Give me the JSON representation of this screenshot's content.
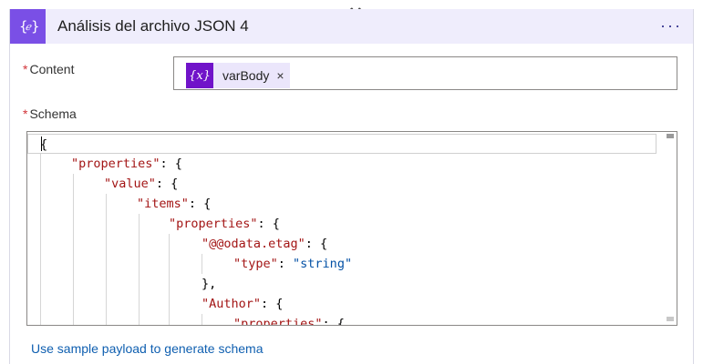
{
  "action": {
    "title": "Análisis del archivo JSON 4",
    "more_label": "···"
  },
  "content_field": {
    "label": "Content",
    "required_mark": "*",
    "token": {
      "icon_text": "{x}",
      "label": "varBody",
      "remove_label": "×"
    }
  },
  "schema_field": {
    "label": "Schema",
    "required_mark": "*"
  },
  "schema_lines": [
    "{",
    "\"properties\": {",
    "\"value\": {",
    "\"items\": {",
    "\"properties\": {",
    "\"@@odata.etag\": {",
    "\"type\": \"string\"",
    "},",
    "\"Author\": {",
    "\"properties\": {"
  ],
  "sample_link": "Use sample payload to generate schema",
  "colors": {
    "header_bg": "#efedfc",
    "icon_bg": "#7a4fe6",
    "token_icon_bg": "#7013c9",
    "json_key": "#a31515",
    "json_string": "#0451a5",
    "link": "#0f5fb0",
    "required": "#d13438"
  },
  "icons": {
    "action": "json-parse-icon",
    "connector": "arrow-down-icon",
    "token": "variable-icon",
    "more": "more-options-icon"
  }
}
